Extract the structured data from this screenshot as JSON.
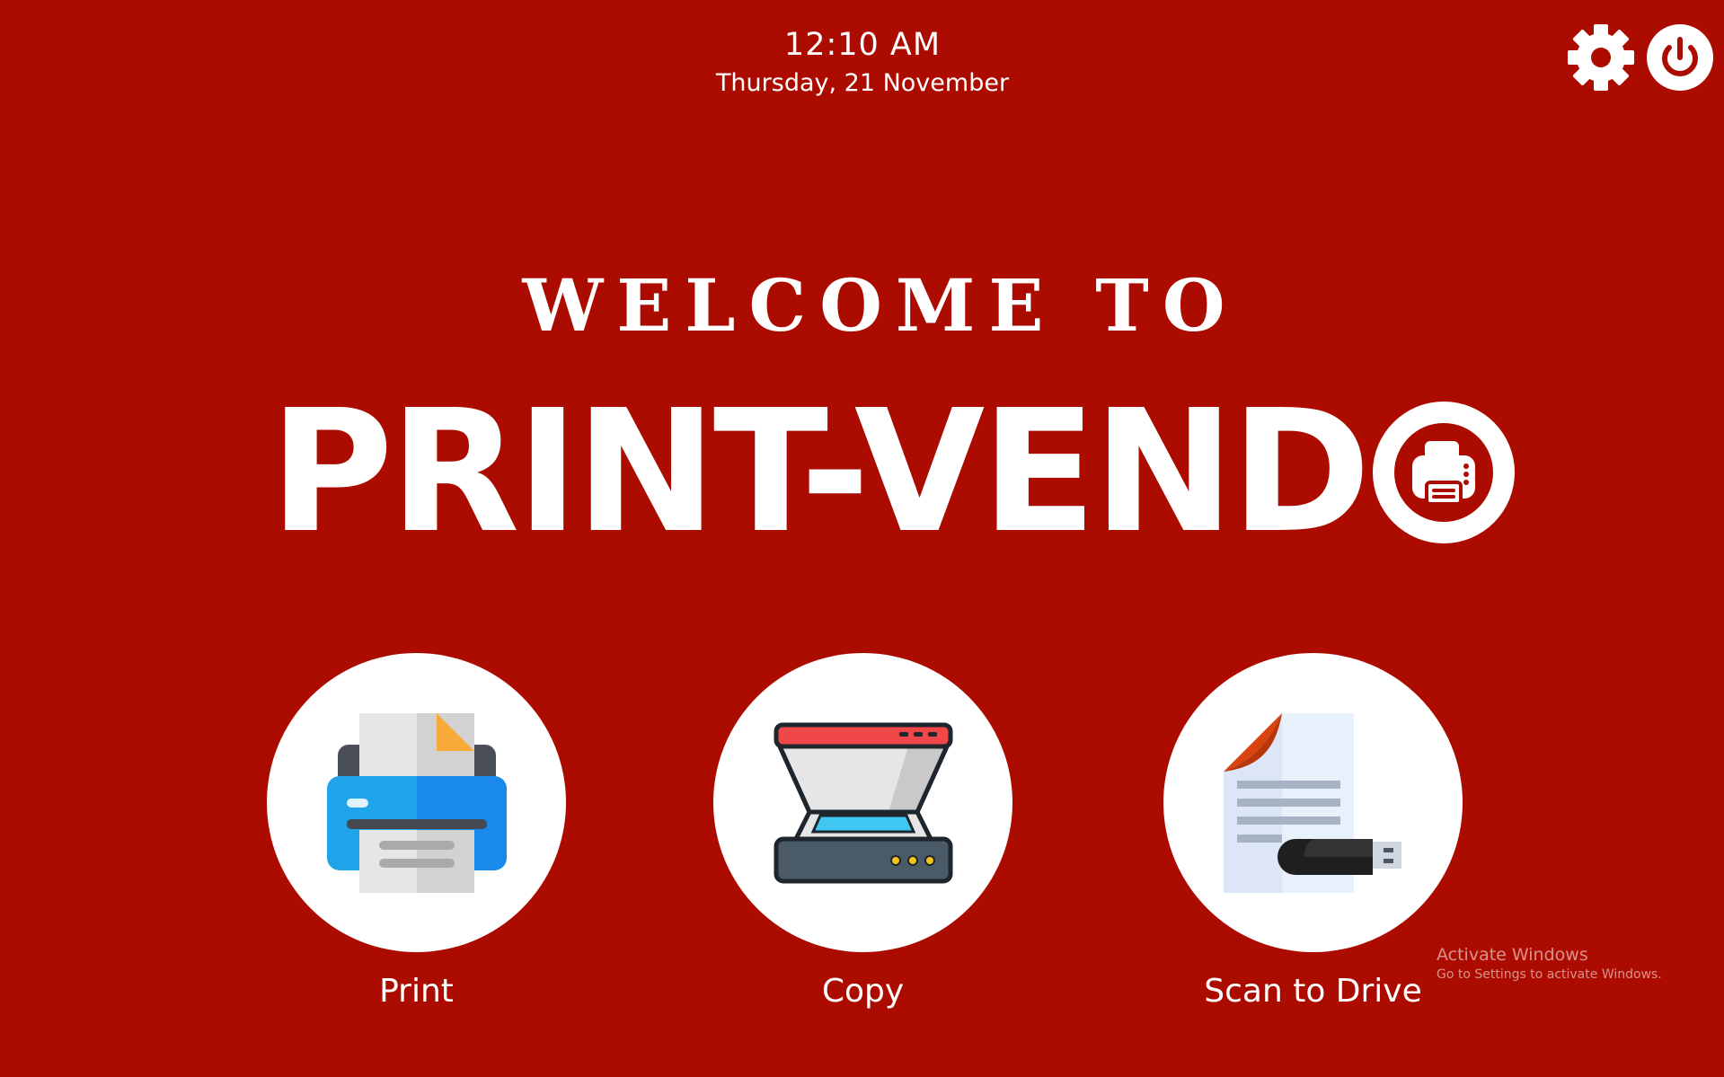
{
  "clock": {
    "time": "12:10 AM",
    "date": "Thursday, 21 November"
  },
  "toolbar": {
    "settings_icon": "gear-icon",
    "power_icon": "power-icon"
  },
  "hero": {
    "welcome": "WELCOME TO",
    "brand": "PRINT-VEND",
    "brand_logo_icon": "printer-circle-logo"
  },
  "options": [
    {
      "label": "Print",
      "icon": "printer-icon"
    },
    {
      "label": "Copy",
      "icon": "scanner-icon"
    },
    {
      "label": "Scan to Drive",
      "icon": "document-usb-icon"
    }
  ],
  "watermark": {
    "title": "Activate Windows",
    "subtitle": "Go to Settings to activate Windows."
  },
  "colors": {
    "background": "#ac0b00",
    "foreground": "#ffffff"
  }
}
